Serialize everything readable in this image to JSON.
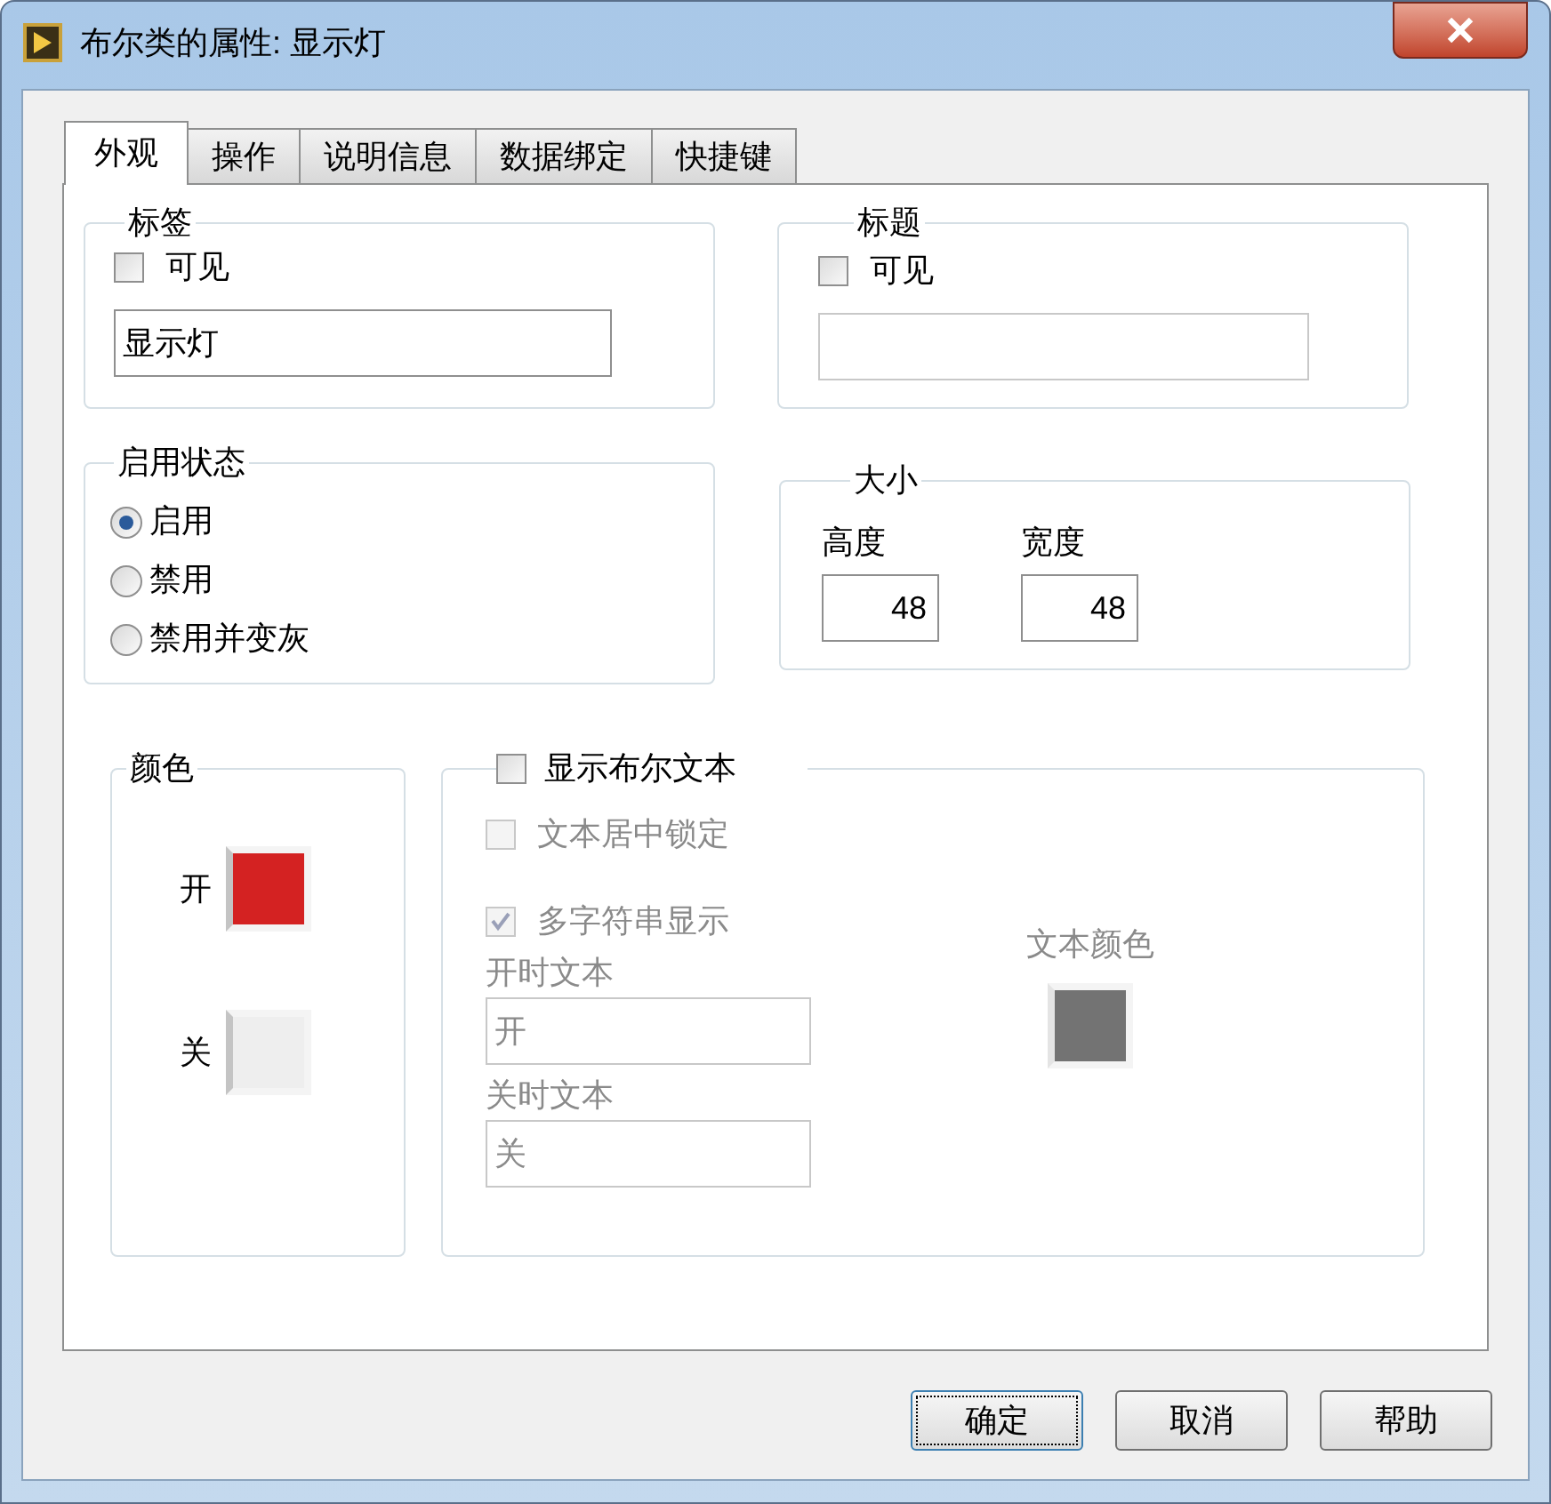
{
  "window": {
    "title": "布尔类的属性: 显示灯"
  },
  "tabs": [
    {
      "label": "外观",
      "selected": true
    },
    {
      "label": "操作",
      "selected": false
    },
    {
      "label": "说明信息",
      "selected": false
    },
    {
      "label": "数据绑定",
      "selected": false
    },
    {
      "label": "快捷键",
      "selected": false
    }
  ],
  "label_group": {
    "title": "标签",
    "visible": {
      "label": "可见",
      "checked": false
    },
    "value": "显示灯"
  },
  "caption_group": {
    "title": "标题",
    "visible": {
      "label": "可见",
      "checked": false
    }
  },
  "enabled_state": {
    "title": "启用状态",
    "options": [
      {
        "label": "启用",
        "selected": true
      },
      {
        "label": "禁用",
        "selected": false
      },
      {
        "label": "禁用并变灰",
        "selected": false
      }
    ]
  },
  "size": {
    "title": "大小",
    "height": {
      "label": "高度",
      "value": "48"
    },
    "width": {
      "label": "宽度",
      "value": "48"
    }
  },
  "colors": {
    "title": "颜色",
    "items": [
      {
        "label": "开",
        "color": "#d42222"
      },
      {
        "label": "关",
        "color": "#eeeeee"
      }
    ]
  },
  "boolean_text": {
    "show": {
      "label": "显示布尔文本",
      "checked": false
    },
    "center_lock": {
      "label": "文本居中锁定",
      "checked": false,
      "disabled": true
    },
    "multi_string": {
      "label": "多字符串显示",
      "checked": true,
      "disabled": true
    },
    "on_text": {
      "label": "开时文本",
      "value": "开",
      "disabled": true
    },
    "off_text": {
      "label": "关时文本",
      "value": "关",
      "disabled": true
    },
    "text_color": {
      "label": "文本颜色",
      "color": "#737373",
      "disabled": true
    }
  },
  "buttons": [
    {
      "label": "确定",
      "focused": true
    },
    {
      "label": "取消",
      "focused": false
    },
    {
      "label": "帮助",
      "focused": false
    }
  ]
}
